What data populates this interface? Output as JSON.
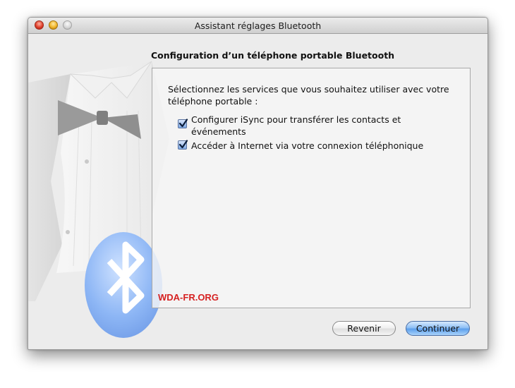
{
  "window": {
    "title": "Assistant réglages Bluetooth",
    "controls": [
      "close-button",
      "minimize-button",
      "zoom-button"
    ]
  },
  "heading": "Configuration d’un téléphone portable Bluetooth",
  "prompt": "Sélectionnez les services que vous souhaitez utiliser avec votre téléphone portable :",
  "options": [
    {
      "label": "Configurer iSync pour transférer les contacts et événements",
      "checked": true
    },
    {
      "label": "Accéder à Internet via votre connexion téléphonique",
      "checked": true
    }
  ],
  "watermark": "WDA-FR.ORG",
  "buttons": {
    "back": "Revenir",
    "continue": "Continuer"
  },
  "colors": {
    "accent": "#5d9fec",
    "watermark": "#d62222",
    "window_bg": "#ececec"
  }
}
